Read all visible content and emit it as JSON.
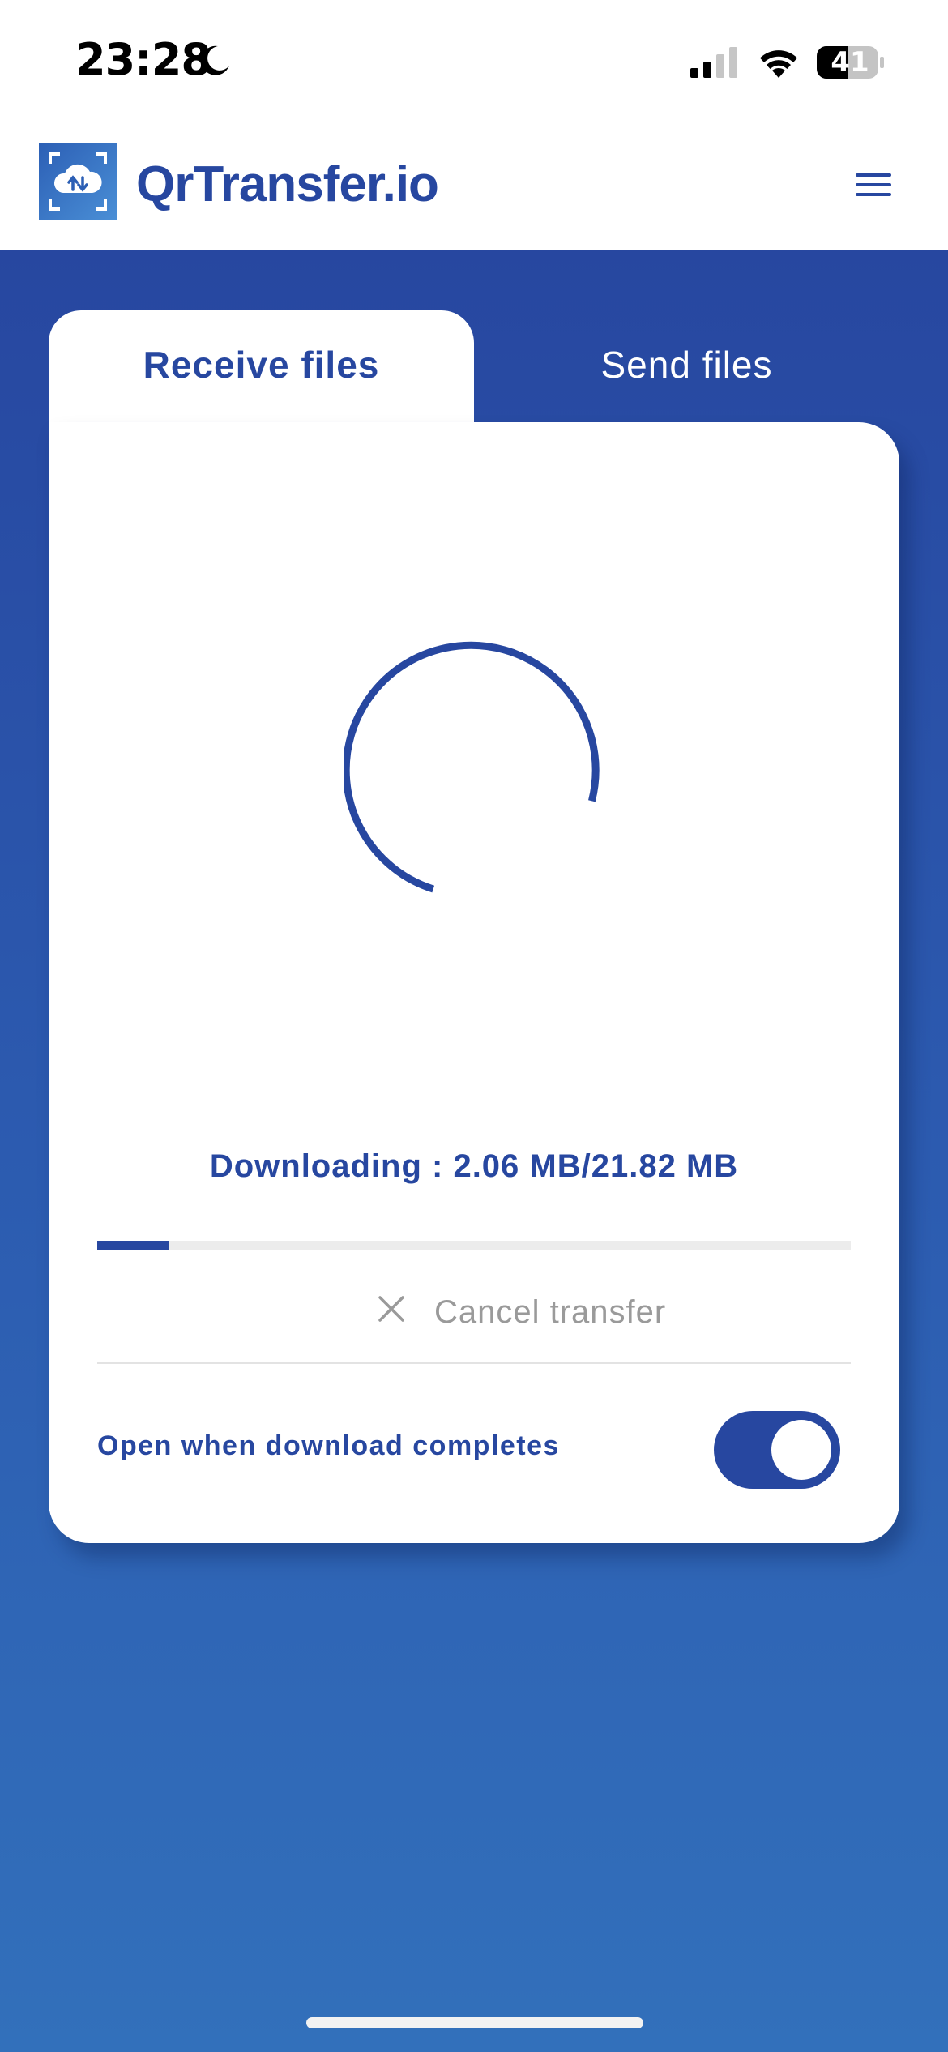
{
  "status_bar": {
    "time": "23:28",
    "battery": "41",
    "icons": [
      "moon-icon",
      "signal-icon",
      "wifi-icon",
      "battery-icon"
    ]
  },
  "header": {
    "brand": "QrTransfer.io",
    "logo_icon": "cloud-transfer-icon",
    "menu_icon": "hamburger-menu-icon"
  },
  "tabs": {
    "receive_label": "Receive files",
    "send_label": "Send files",
    "active": "receive"
  },
  "transfer": {
    "status_text": "Downloading : 2.06 MB/21.82 MB",
    "downloaded_mb": 2.06,
    "total_mb": 21.82,
    "progress_fraction": 0.0944,
    "cancel_label": "Cancel transfer",
    "open_when_complete_label": "Open when download completes",
    "open_when_complete": true
  },
  "colors": {
    "brand_blue": "#2747a0",
    "background_gradient_top": "#2747a0",
    "background_gradient_bottom": "#3270bb",
    "muted_text": "#9a9a9a",
    "track": "#ececec"
  }
}
